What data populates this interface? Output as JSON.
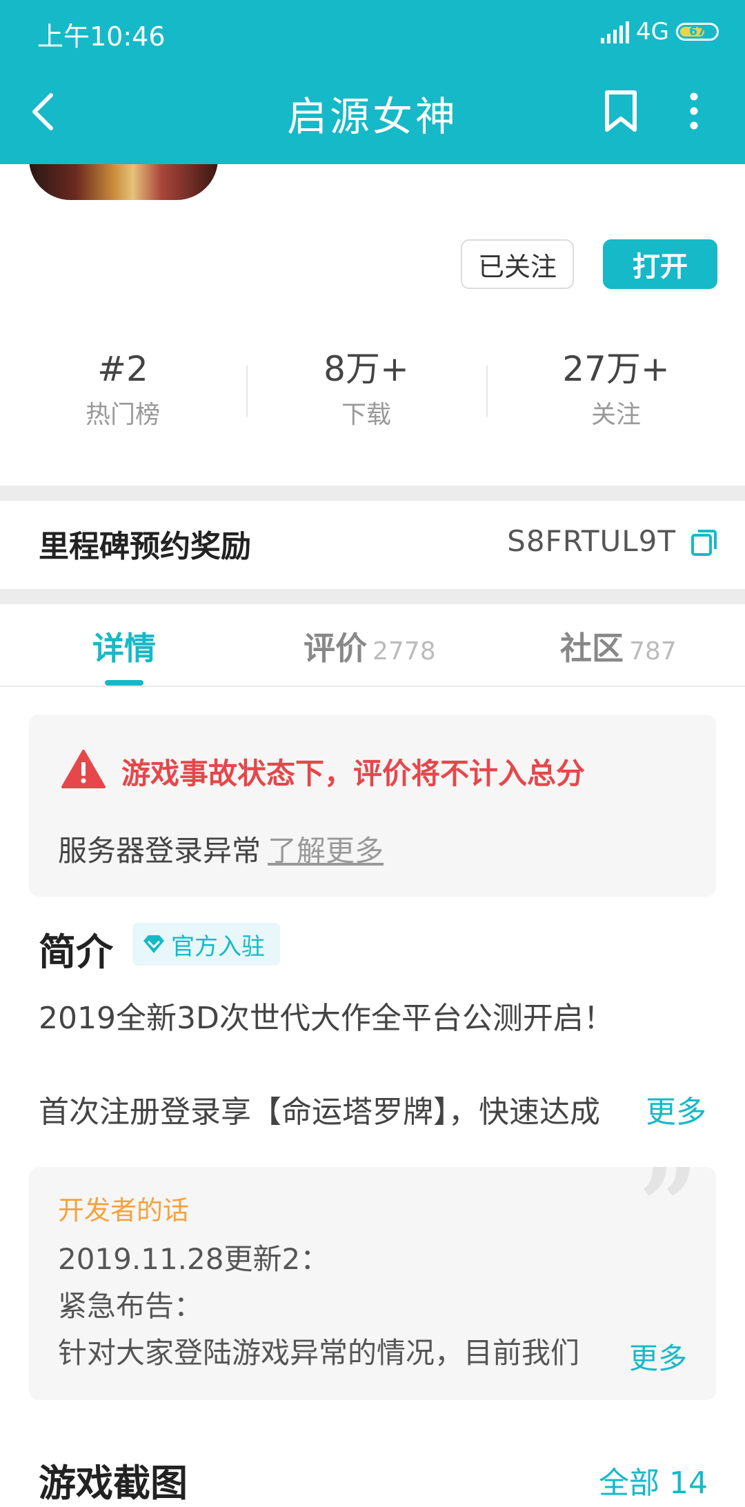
{
  "status_bar": {
    "time": "上午10:46",
    "network": "4G",
    "battery": "67"
  },
  "nav": {
    "title": "启源女神"
  },
  "actions": {
    "follow_label": "已关注",
    "open_label": "打开"
  },
  "stats": [
    {
      "value": "#2",
      "label": "热门榜"
    },
    {
      "value": "8万+",
      "label": "下载"
    },
    {
      "value": "27万+",
      "label": "关注"
    }
  ],
  "milestone": {
    "title": "里程碑预约奖励",
    "code": "S8FRTUL9T"
  },
  "tabs": [
    {
      "label": "详情",
      "count": ""
    },
    {
      "label": "评价",
      "count": "2778"
    },
    {
      "label": "社区",
      "count": "787"
    }
  ],
  "notice": {
    "title": "游戏事故状态下，评价将不计入总分",
    "body": "服务器登录异常",
    "link": "了解更多"
  },
  "intro": {
    "title": "简介",
    "badge": "官方入驻",
    "line1": "2019全新3D次世代大作全平台公测开启！",
    "line2": "首次注册登录享【命运塔罗牌】，快速达成",
    "more": "更多"
  },
  "developer": {
    "title": "开发者的话",
    "line1": "2019.11.28更新2：",
    "line2": "紧急布告：",
    "line3": "针对大家登陆游戏异常的情况，目前我们",
    "more": "更多"
  },
  "screenshots": {
    "title": "游戏截图",
    "all_label": "全部 14"
  },
  "colors": {
    "accent": "#16b9c8",
    "warning": "#e5474b",
    "dev_title": "#f5a23c"
  }
}
